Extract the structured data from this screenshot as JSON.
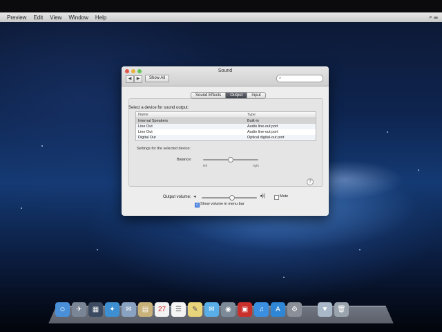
{
  "menubar": {
    "items": [
      "Preview",
      "Edit",
      "View",
      "Window",
      "Help"
    ]
  },
  "window": {
    "title": "Sound",
    "show_all": "Show All",
    "search_placeholder": "",
    "tabs": [
      {
        "label": "Sound Effects",
        "active": false
      },
      {
        "label": "Output",
        "active": true
      },
      {
        "label": "Input",
        "active": false
      }
    ],
    "heading": "Select a device for sound output:",
    "table": {
      "columns": [
        "Name",
        "Type"
      ],
      "rows": [
        {
          "name": "Internal Speakers",
          "type": "Built-in",
          "selected": true
        },
        {
          "name": "Line Out",
          "type": "Audio line-out port",
          "selected": false
        },
        {
          "name": "Line Out",
          "type": "Audio line-out port",
          "selected": false
        },
        {
          "name": "Digital Out",
          "type": "Optical digital-out port",
          "selected": false
        }
      ]
    },
    "settings_heading": "Settings for the selected device:",
    "balance": {
      "label": "Balance:",
      "left": "left",
      "right": "right",
      "value": 0.5
    },
    "output_volume": {
      "label": "Output volume:",
      "value": 0.55,
      "mute_label": "Mute",
      "mute_checked": false
    },
    "show_volume": {
      "label": "Show volume in menu bar",
      "checked": true
    },
    "help": "?"
  },
  "dock": {
    "icons": [
      "finder-icon",
      "launchpad-icon",
      "mission-control-icon",
      "safari-icon",
      "mail-icon",
      "contacts-icon",
      "calendar-icon",
      "reminders-icon",
      "notes-icon",
      "messages-icon",
      "facetime-icon",
      "photo-booth-icon",
      "itunes-icon",
      "app-store-icon",
      "system-preferences-icon",
      "downloads-icon",
      "trash-icon"
    ],
    "calendar_day": "27"
  },
  "colors": {
    "accent": "#5b8fe6",
    "active_tab": "#3e424a"
  }
}
